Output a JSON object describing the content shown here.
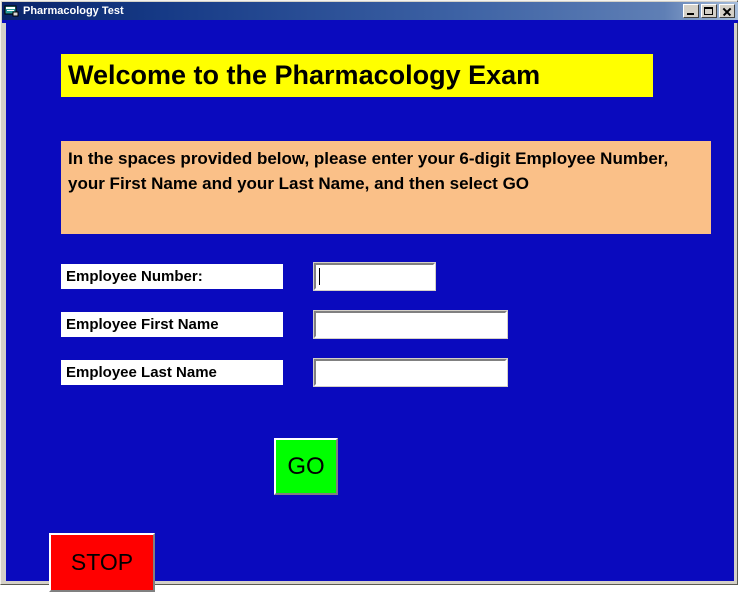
{
  "window": {
    "title": "Pharmacology Test",
    "icon": "vb-form-icon",
    "controls": [
      {
        "name": "minimize",
        "icon": "minimize-icon",
        "label": "_"
      },
      {
        "name": "maximize",
        "icon": "maximize-icon",
        "label": "□"
      },
      {
        "name": "close",
        "icon": "close-icon",
        "label": "×"
      }
    ]
  },
  "form": {
    "background_color": "#0a0abe",
    "banner": {
      "text": "Welcome to the Pharmacology Exam",
      "background_color": "#ffff00",
      "text_color": "#000000"
    },
    "instructions": {
      "text": "In the spaces provided below, please enter your 6-digit Employee Number, your First Name and your Last Name, and then select GO",
      "background_color": "#fac088",
      "text_color": "#000000"
    },
    "fields": [
      {
        "label": "Employee Number:",
        "value": "",
        "placeholder": "",
        "focused": true,
        "name": "employee-number"
      },
      {
        "label": "Employee First Name",
        "value": "",
        "placeholder": "",
        "focused": false,
        "name": "employee-first-name"
      },
      {
        "label": "Employee Last Name",
        "value": "",
        "placeholder": "",
        "focused": false,
        "name": "employee-last-name"
      }
    ],
    "buttons": [
      {
        "label": "GO",
        "color": "#00ff00",
        "text_color": "#000000",
        "name": "go"
      },
      {
        "label": "STOP",
        "color": "#ff0000",
        "text_color": "#000000",
        "name": "stop"
      }
    ]
  }
}
